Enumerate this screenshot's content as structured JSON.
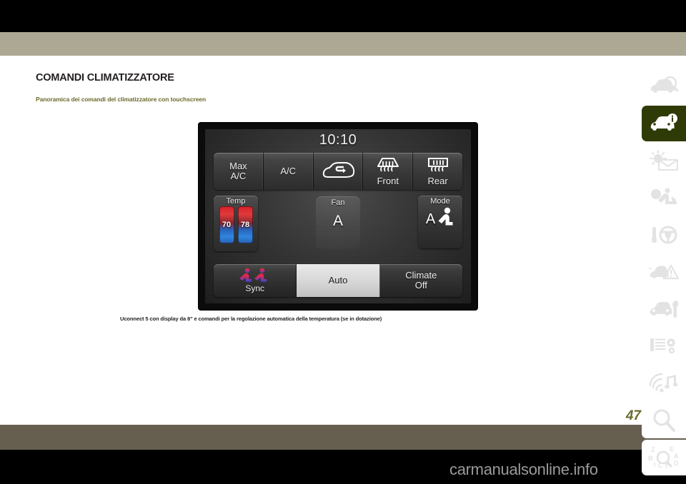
{
  "page": {
    "title": "COMANDI CLIMATIZZATORE",
    "subtitle": "Panoramica dei comandi del climatizzatore con touchscreen",
    "caption": "Uconnect 5 con display da 8\" e comandi per la regolazione automatica della temperatura (se in dotazione)",
    "page_number": "47",
    "watermark": "carmanualsonline.info",
    "band_tan_color": "#aca894",
    "band_bottom_color": "#665f50",
    "accent_color": "#6b6b2e",
    "tab_selected_color": "#2f3b06"
  },
  "radio": {
    "clock": "10:10",
    "top_row": [
      {
        "line1": "Max",
        "line2": "A/C",
        "icon": "none",
        "name": "max-ac-button"
      },
      {
        "line1": "A/C",
        "line2": "",
        "icon": "none",
        "name": "ac-button"
      },
      {
        "line1": "",
        "line2": "",
        "icon": "recirculation-icon",
        "name": "recirculation-button"
      },
      {
        "line1": "",
        "line2": "Front",
        "icon": "front-defrost-icon",
        "name": "front-defrost-button"
      },
      {
        "line1": "",
        "line2": "Rear",
        "icon": "rear-defrost-icon",
        "name": "rear-defrost-button"
      }
    ],
    "temp": {
      "label": "Temp",
      "driver_value": "70",
      "passenger_value": "78",
      "hot_color": "#d8202a",
      "cold_color": "#2f86e0"
    },
    "fan": {
      "label": "Fan",
      "value": "A"
    },
    "mode": {
      "label": "Mode",
      "value": "A",
      "icon": "seat-airflow-icon"
    },
    "bottom_row": [
      {
        "label": "Sync",
        "line2": "",
        "active": false,
        "icon": "dual-seat-sync-icon",
        "name": "sync-button"
      },
      {
        "label": "Auto",
        "line2": "",
        "active": true,
        "icon": "none",
        "name": "auto-button"
      },
      {
        "label": "Climate",
        "line2": "Off",
        "active": false,
        "icon": "none",
        "name": "climate-off-button"
      }
    ]
  },
  "tabs": [
    {
      "name": "tab-vehicle-overview",
      "icon": "car-magnifier-icon",
      "selected": false
    },
    {
      "name": "tab-vehicle-info",
      "icon": "car-info-icon",
      "selected": true
    },
    {
      "name": "tab-dashboard-warnings",
      "icon": "sun-envelope-icon",
      "selected": false
    },
    {
      "name": "tab-safety",
      "icon": "occupant-safety-icon",
      "selected": false
    },
    {
      "name": "tab-starting-driving",
      "icon": "key-steering-wheel-icon",
      "selected": false
    },
    {
      "name": "tab-emergency",
      "icon": "car-warning-triangle-icon",
      "selected": false
    },
    {
      "name": "tab-maintenance",
      "icon": "car-wrench-icon",
      "selected": false
    },
    {
      "name": "tab-specifications",
      "icon": "list-gears-icon",
      "selected": false
    },
    {
      "name": "tab-multimedia",
      "icon": "wifi-music-icon",
      "selected": false
    },
    {
      "name": "tab-search",
      "icon": "magnifier-icon",
      "selected": false
    },
    {
      "name": "tab-alphabetical-index",
      "icon": "alphabetical-index-icon",
      "selected": false
    }
  ]
}
